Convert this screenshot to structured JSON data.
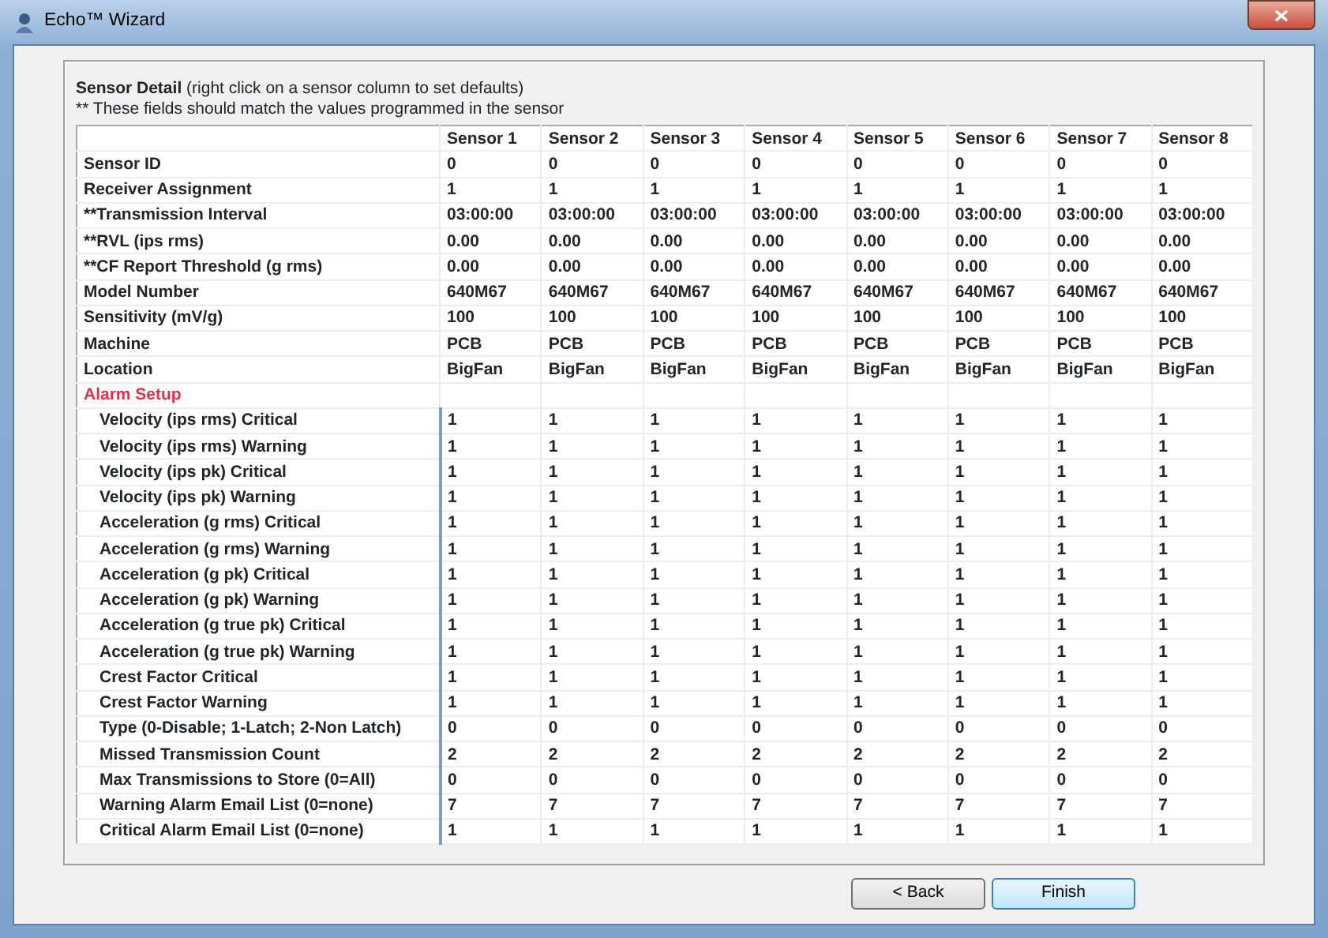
{
  "window": {
    "title": "Echo™ Wizard"
  },
  "heading": {
    "title": "Sensor Detail",
    "hint": "(right click on a sensor column to set defaults)",
    "note": "** These fields should match the values programmed in the sensor"
  },
  "table": {
    "columns": [
      "Sensor 1",
      "Sensor 2",
      "Sensor 3",
      "Sensor 4",
      "Sensor 5",
      "Sensor 6",
      "Sensor 7",
      "Sensor 8"
    ],
    "rows": [
      {
        "kind": "field",
        "label": "Sensor ID",
        "values": [
          "0",
          "0",
          "0",
          "0",
          "0",
          "0",
          "0",
          "0"
        ]
      },
      {
        "kind": "field",
        "label": "Receiver Assignment",
        "values": [
          "1",
          "1",
          "1",
          "1",
          "1",
          "1",
          "1",
          "1"
        ]
      },
      {
        "kind": "field",
        "label": "**Transmission Interval",
        "values": [
          "03:00:00",
          "03:00:00",
          "03:00:00",
          "03:00:00",
          "03:00:00",
          "03:00:00",
          "03:00:00",
          "03:00:00"
        ]
      },
      {
        "kind": "field",
        "label": "**RVL (ips rms)",
        "values": [
          "0.00",
          "0.00",
          "0.00",
          "0.00",
          "0.00",
          "0.00",
          "0.00",
          "0.00"
        ]
      },
      {
        "kind": "field",
        "label": "**CF Report Threshold (g rms)",
        "values": [
          "0.00",
          "0.00",
          "0.00",
          "0.00",
          "0.00",
          "0.00",
          "0.00",
          "0.00"
        ]
      },
      {
        "kind": "field",
        "label": "Model Number",
        "values": [
          "640M67",
          "640M67",
          "640M67",
          "640M67",
          "640M67",
          "640M67",
          "640M67",
          "640M67"
        ]
      },
      {
        "kind": "field",
        "label": "Sensitivity (mV/g)",
        "values": [
          "100",
          "100",
          "100",
          "100",
          "100",
          "100",
          "100",
          "100"
        ]
      },
      {
        "kind": "field",
        "label": "Machine",
        "values": [
          "PCB",
          "PCB",
          "PCB",
          "PCB",
          "PCB",
          "PCB",
          "PCB",
          "PCB"
        ]
      },
      {
        "kind": "field",
        "label": "Location",
        "values": [
          "BigFan",
          "BigFan",
          "BigFan",
          "BigFan",
          "BigFan",
          "BigFan",
          "BigFan",
          "BigFan"
        ]
      },
      {
        "kind": "section",
        "label": "Alarm Setup"
      },
      {
        "kind": "alarm",
        "label": "Velocity (ips rms) Critical",
        "values": [
          "1",
          "1",
          "1",
          "1",
          "1",
          "1",
          "1",
          "1"
        ]
      },
      {
        "kind": "alarm",
        "label": "Velocity (ips rms) Warning",
        "values": [
          "1",
          "1",
          "1",
          "1",
          "1",
          "1",
          "1",
          "1"
        ]
      },
      {
        "kind": "alarm",
        "label": "Velocity (ips pk) Critical",
        "values": [
          "1",
          "1",
          "1",
          "1",
          "1",
          "1",
          "1",
          "1"
        ]
      },
      {
        "kind": "alarm",
        "label": "Velocity (ips pk) Warning",
        "values": [
          "1",
          "1",
          "1",
          "1",
          "1",
          "1",
          "1",
          "1"
        ]
      },
      {
        "kind": "alarm",
        "label": "Acceleration (g rms) Critical",
        "values": [
          "1",
          "1",
          "1",
          "1",
          "1",
          "1",
          "1",
          "1"
        ]
      },
      {
        "kind": "alarm",
        "label": "Acceleration (g rms) Warning",
        "values": [
          "1",
          "1",
          "1",
          "1",
          "1",
          "1",
          "1",
          "1"
        ]
      },
      {
        "kind": "alarm",
        "label": "Acceleration (g pk) Critical",
        "values": [
          "1",
          "1",
          "1",
          "1",
          "1",
          "1",
          "1",
          "1"
        ]
      },
      {
        "kind": "alarm",
        "label": "Acceleration (g pk) Warning",
        "values": [
          "1",
          "1",
          "1",
          "1",
          "1",
          "1",
          "1",
          "1"
        ]
      },
      {
        "kind": "alarm",
        "label": "Acceleration (g true pk) Critical",
        "values": [
          "1",
          "1",
          "1",
          "1",
          "1",
          "1",
          "1",
          "1"
        ]
      },
      {
        "kind": "alarm",
        "label": "Acceleration (g true pk) Warning",
        "values": [
          "1",
          "1",
          "1",
          "1",
          "1",
          "1",
          "1",
          "1"
        ]
      },
      {
        "kind": "alarm",
        "label": "Crest Factor Critical",
        "values": [
          "1",
          "1",
          "1",
          "1",
          "1",
          "1",
          "1",
          "1"
        ]
      },
      {
        "kind": "alarm",
        "label": "Crest Factor Warning",
        "values": [
          "1",
          "1",
          "1",
          "1",
          "1",
          "1",
          "1",
          "1"
        ]
      },
      {
        "kind": "alarm",
        "label": "Type (0-Disable; 1-Latch; 2-Non Latch)",
        "values": [
          "0",
          "0",
          "0",
          "0",
          "0",
          "0",
          "0",
          "0"
        ]
      },
      {
        "kind": "alarm",
        "label": "Missed Transmission Count",
        "values": [
          "2",
          "2",
          "2",
          "2",
          "2",
          "2",
          "2",
          "2"
        ]
      },
      {
        "kind": "alarm",
        "label": "Max Transmissions to Store (0=All)",
        "values": [
          "0",
          "0",
          "0",
          "0",
          "0",
          "0",
          "0",
          "0"
        ]
      },
      {
        "kind": "alarm",
        "label": "Warning Alarm Email List (0=none)",
        "values": [
          "7",
          "7",
          "7",
          "7",
          "7",
          "7",
          "7",
          "7"
        ]
      },
      {
        "kind": "alarm",
        "label": "Critical Alarm Email List (0=none)",
        "values": [
          "1",
          "1",
          "1",
          "1",
          "1",
          "1",
          "1",
          "1"
        ]
      }
    ]
  },
  "buttons": [
    {
      "label": "< Back",
      "default": false
    },
    {
      "label": "Finish",
      "default": true
    }
  ]
}
